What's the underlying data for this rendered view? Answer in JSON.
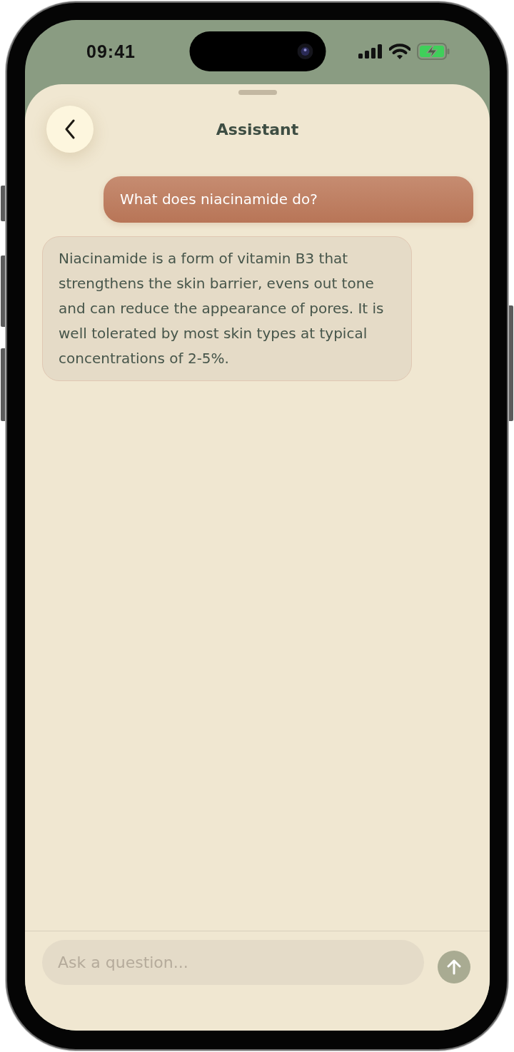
{
  "status_bar": {
    "time": "09:41"
  },
  "header": {
    "title": "Assistant"
  },
  "messages": [
    {
      "kind": "user",
      "text": "What does niacinamide do?"
    },
    {
      "kind": "assistant",
      "text": "Niacinamide is a form of vitamin B3 that strengthens the skin barrier, evens out tone and can reduce the appearance of pores. It is well tolerated by most skin types at typical concentrations of 2-5%."
    }
  ],
  "composer": {
    "placeholder": "Ask a question..."
  }
}
